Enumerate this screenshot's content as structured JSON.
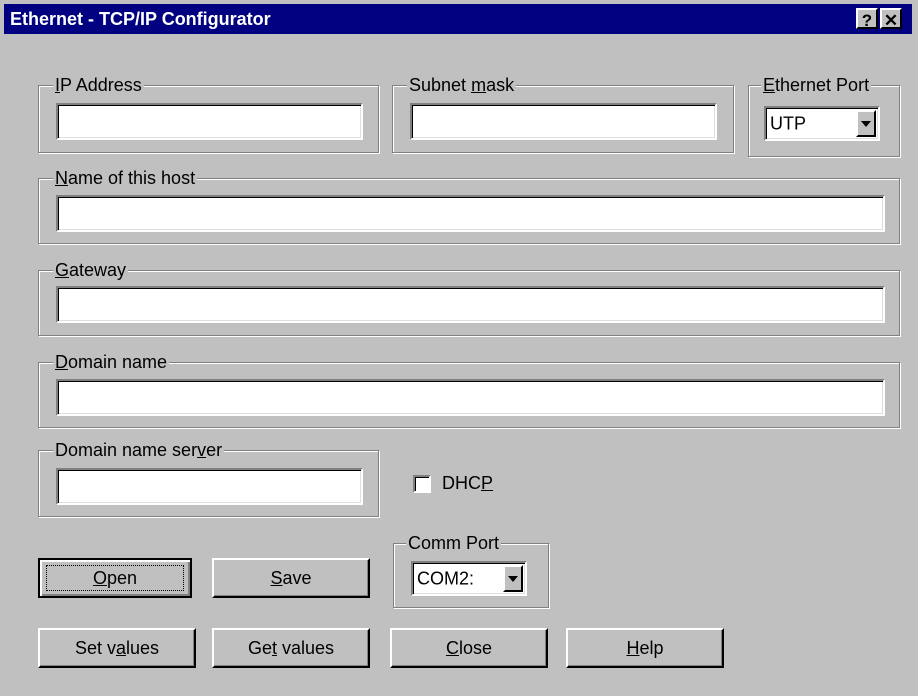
{
  "window": {
    "title": "Ethernet - TCP/IP Configurator",
    "help_button": "?",
    "close_button": "✕"
  },
  "ip_address": {
    "label_pre": "",
    "label_u": "I",
    "label_post": "P Address",
    "value": ""
  },
  "subnet_mask": {
    "label_pre": "Subnet ",
    "label_u": "m",
    "label_post": "ask",
    "value": ""
  },
  "ethernet_port": {
    "label_pre": "",
    "label_u": "E",
    "label_post": "thernet Port",
    "value": "UTP"
  },
  "host_name": {
    "label_pre": "",
    "label_u": "N",
    "label_post": "ame of this host",
    "value": ""
  },
  "gateway": {
    "label_pre": "",
    "label_u": "G",
    "label_post": "ateway",
    "value": ""
  },
  "domain_name": {
    "label_pre": "",
    "label_u": "D",
    "label_post": "omain name",
    "value": ""
  },
  "domain_name_server": {
    "label_pre": "Domain name ser",
    "label_u": "v",
    "label_post": "er",
    "value": ""
  },
  "dhcp": {
    "label_pre": "DHC",
    "label_u": "P",
    "label_post": "",
    "checked": false
  },
  "comm_port": {
    "label": "Comm Port",
    "value": "COM2:"
  },
  "buttons": {
    "open": {
      "pre": "",
      "u": "O",
      "post": "pen"
    },
    "save": {
      "pre": "",
      "u": "S",
      "post": "ave"
    },
    "set_values": {
      "pre": "Set v",
      "u": "a",
      "post": "lues"
    },
    "get_values": {
      "pre": "Ge",
      "u": "t",
      "post": " values"
    },
    "close": {
      "pre": "",
      "u": "C",
      "post": "lose"
    },
    "help": {
      "pre": "",
      "u": "H",
      "post": "elp"
    }
  }
}
